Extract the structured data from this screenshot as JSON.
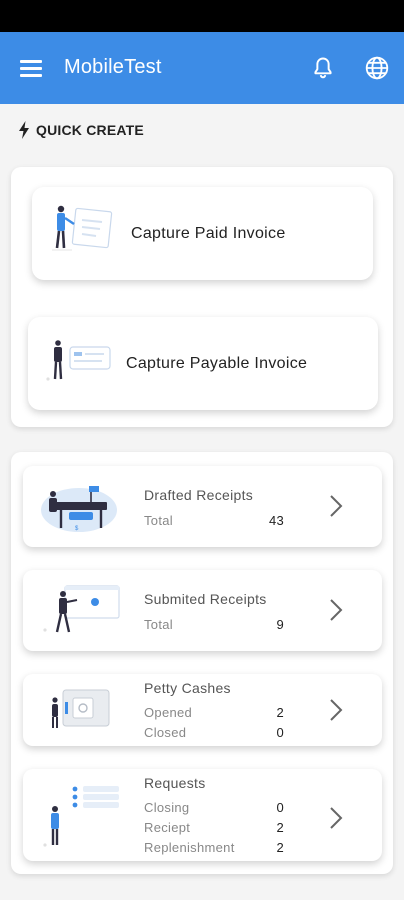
{
  "app": {
    "title": "MobileTest",
    "icons": {
      "menu": "menu-icon",
      "notifications": "bell-icon",
      "language": "globe-icon"
    },
    "accent": "#3d8ce6"
  },
  "quick_create": {
    "heading": "QUICK CREATE",
    "icon": "lightning-icon",
    "actions": [
      {
        "label": "Capture Paid Invoice"
      },
      {
        "label": "Capture Payable Invoice"
      }
    ]
  },
  "summaries": [
    {
      "title": "Drafted Receipts",
      "rows": [
        {
          "label": "Total",
          "value": "43"
        }
      ]
    },
    {
      "title": "Submited Receipts",
      "rows": [
        {
          "label": "Total",
          "value": "9"
        }
      ]
    },
    {
      "title": "Petty Cashes",
      "rows": [
        {
          "label": "Opened",
          "value": "2"
        },
        {
          "label": "Closed",
          "value": "0"
        }
      ]
    },
    {
      "title": "Requests",
      "rows": [
        {
          "label": "Closing",
          "value": "0"
        },
        {
          "label": "Reciept",
          "value": "2"
        },
        {
          "label": "Replenishment",
          "value": "2"
        }
      ]
    }
  ]
}
